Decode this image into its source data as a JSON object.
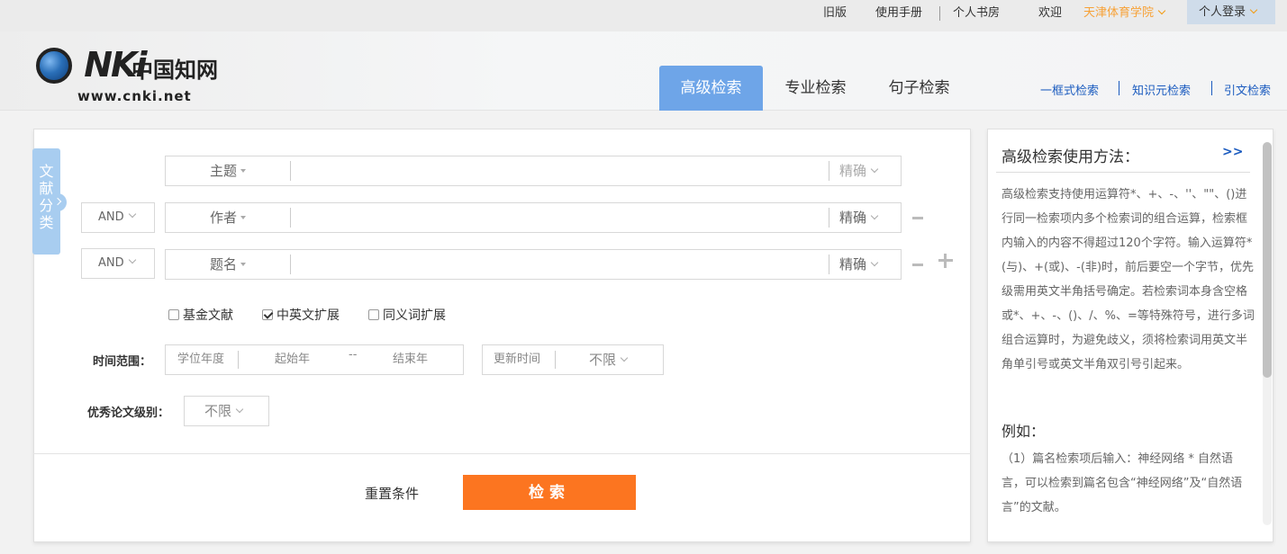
{
  "topbar": {
    "old_version": "旧版",
    "manual": "使用手册",
    "personal_library": "个人书房",
    "welcome": "欢迎",
    "institution": "天津体育学院",
    "personal_login": "个人登录"
  },
  "logo": {
    "letters": "CNKI",
    "chinese": "中国知网",
    "url": "www.cnki.net"
  },
  "tabs": [
    "高级检索",
    "专业检索",
    "句子检索"
  ],
  "quick_links": [
    "一框式检索",
    "知识元检索",
    "引文检索"
  ],
  "category_tab": "文献分类",
  "rows": [
    {
      "logic": "",
      "field": "主题",
      "value": "",
      "precision": "精确"
    },
    {
      "logic": "AND",
      "field": "作者",
      "value": "",
      "precision": "精确"
    },
    {
      "logic": "AND",
      "field": "题名",
      "value": "",
      "precision": "精确"
    }
  ],
  "checkboxes": [
    {
      "label": "基金文献",
      "checked": false
    },
    {
      "label": "中英文扩展",
      "checked": true
    },
    {
      "label": "同义词扩展",
      "checked": false
    }
  ],
  "time_range": {
    "label": "时间范围：",
    "type": "学位年度",
    "start_placeholder": "起始年",
    "dash": "--",
    "end_placeholder": "结束年",
    "update_label": "更新时间",
    "update_value": "不限"
  },
  "excellent": {
    "label": "优秀论文级别：",
    "value": "不限"
  },
  "actions": {
    "reset": "重置条件",
    "search": "检索"
  },
  "help": {
    "title": "高级检索使用方法：",
    "more": ">>",
    "body": "高级检索支持使用运算符*、+、-、''、\"\"、()进行同一检索项内多个检索词的组合运算，检索框内输入的内容不得超过120个字符。输入运算符*(与)、+(或)、-(非)时，前后要空一个字节，优先级需用英文半角括号确定。若检索词本身含空格或*、+、-、()、/、%、=等特殊符号，进行多词组合运算时，为避免歧义，须将检索词用英文半角单引号或英文半角双引号引起来。",
    "example_title": "例如：",
    "example_body": "（1）篇名检索项后输入：神经网络 * 自然语言，可以检索到篇名包含“神经网络”及“自然语言”的文献。"
  },
  "colors": {
    "accent": "#6ea5e8",
    "search_button": "#fc7520",
    "link": "#1b5bbf",
    "institution": "#f7a136"
  }
}
